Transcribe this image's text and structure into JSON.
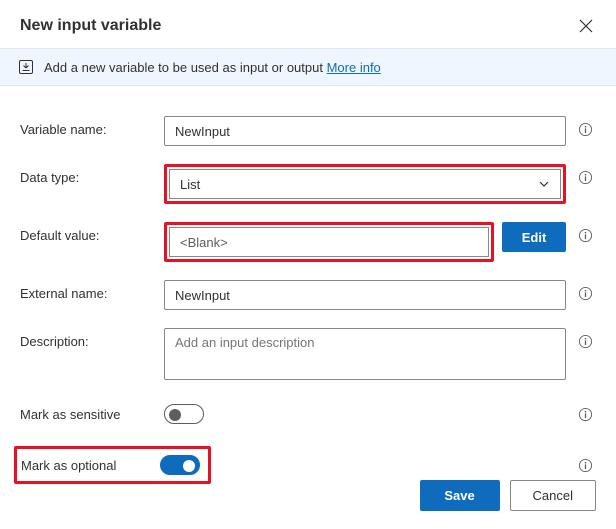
{
  "dialog": {
    "title": "New input variable",
    "banner_text": "Add a new variable to be used as input or output ",
    "banner_link": "More info"
  },
  "form": {
    "variable_name": {
      "label": "Variable name:",
      "value": "NewInput"
    },
    "data_type": {
      "label": "Data type:",
      "value": "List"
    },
    "default_value": {
      "label": "Default value:",
      "value": "<Blank>",
      "edit_label": "Edit"
    },
    "external_name": {
      "label": "External name:",
      "value": "NewInput"
    },
    "description": {
      "label": "Description:",
      "placeholder": "Add an input description"
    },
    "mark_sensitive": {
      "label": "Mark as sensitive",
      "on": false
    },
    "mark_optional": {
      "label": "Mark as optional",
      "on": true
    }
  },
  "footer": {
    "save": "Save",
    "cancel": "Cancel"
  }
}
